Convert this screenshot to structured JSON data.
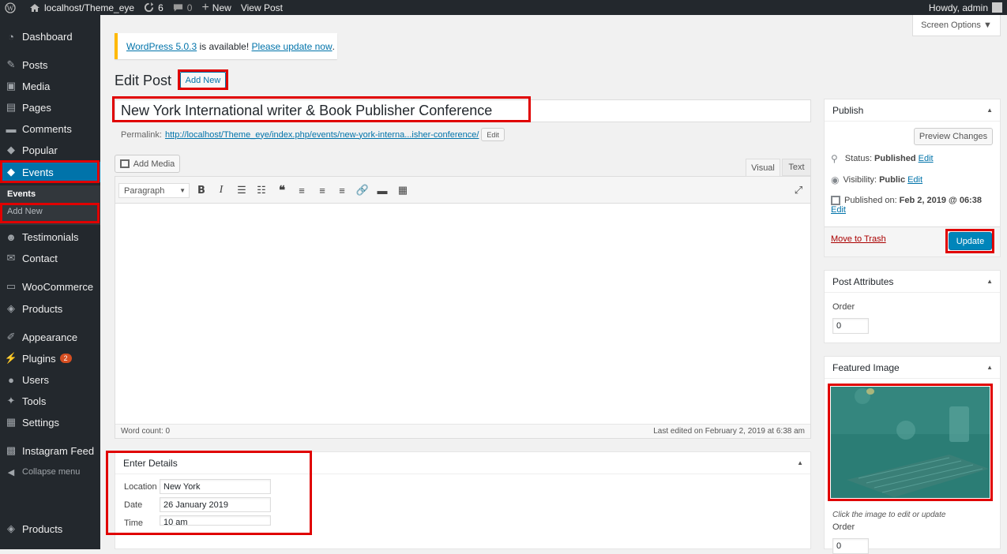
{
  "adminbar": {
    "site": "localhost/Theme_eye",
    "updates": "6",
    "comments": "0",
    "new": "New",
    "view_post": "View Post",
    "howdy": "Howdy, admin"
  },
  "sidebar": {
    "items": [
      {
        "label": "Dashboard",
        "icon": "dashboard-icon"
      },
      {
        "label": "Posts",
        "icon": "pin-icon"
      },
      {
        "label": "Media",
        "icon": "media-icon"
      },
      {
        "label": "Pages",
        "icon": "pages-icon"
      },
      {
        "label": "Comments",
        "icon": "comment-icon"
      },
      {
        "label": "Popular",
        "icon": "tag-icon"
      },
      {
        "label": "Events",
        "icon": "tag-icon"
      },
      {
        "label": "Testimonials",
        "icon": "users-icon"
      },
      {
        "label": "Contact",
        "icon": "mail-icon"
      },
      {
        "label": "WooCommerce",
        "icon": "woo-icon"
      },
      {
        "label": "Products",
        "icon": "box-icon"
      },
      {
        "label": "Appearance",
        "icon": "brush-icon"
      },
      {
        "label": "Plugins",
        "icon": "plug-icon",
        "badge": "2"
      },
      {
        "label": "Users",
        "icon": "user-icon"
      },
      {
        "label": "Tools",
        "icon": "wrench-icon"
      },
      {
        "label": "Settings",
        "icon": "settings-icon"
      },
      {
        "label": "Instagram Feed",
        "icon": "camera-icon"
      },
      {
        "label": "Collapse menu",
        "icon": "collapse-icon"
      },
      {
        "label": "Products",
        "icon": "box-icon"
      }
    ],
    "submenu": {
      "current": "Events",
      "add_new": "Add New"
    }
  },
  "notice": {
    "version_link": "WordPress 5.0.3",
    "middle": " is available! ",
    "update_link": "Please update now",
    "end": "."
  },
  "screen_options": "Screen Options ▼",
  "page_title": "Edit Post",
  "add_new": "Add New",
  "post_title": "New York International writer & Book Publisher Conference",
  "permalink": {
    "label": "Permalink:",
    "url": "http://localhost/Theme_eye/index.php/events/new-york-interna...isher-conference/",
    "edit": "Edit"
  },
  "editor": {
    "add_media": "Add Media",
    "tab_visual": "Visual",
    "tab_text": "Text",
    "format": "Paragraph",
    "word_count": "Word count: 0",
    "last_edited": "Last edited on February 2, 2019 at 6:38 am"
  },
  "details": {
    "title": "Enter Details",
    "location_label": "Location",
    "location": "New York",
    "date_label": "Date",
    "date": "26 January 2019",
    "time_label": "Time",
    "time": "10 am"
  },
  "publish": {
    "title": "Publish",
    "preview": "Preview Changes",
    "status_label": "Status:",
    "status": "Published",
    "status_edit": "Edit",
    "visibility_label": "Visibility:",
    "visibility": "Public",
    "visibility_edit": "Edit",
    "published_label": "Published on:",
    "published": "Feb 2, 2019 @ 06:38",
    "published_edit": "Edit",
    "trash": "Move to Trash",
    "update": "Update"
  },
  "attributes": {
    "title": "Post Attributes",
    "order_label": "Order",
    "order": "0"
  },
  "featured": {
    "title": "Featured Image",
    "hint": "Click the image to edit or update",
    "order_label": "Order",
    "order": "0"
  },
  "colors": {
    "accent": "#0073aa",
    "highlight": "#e00000",
    "sidebar": "#23282d"
  }
}
